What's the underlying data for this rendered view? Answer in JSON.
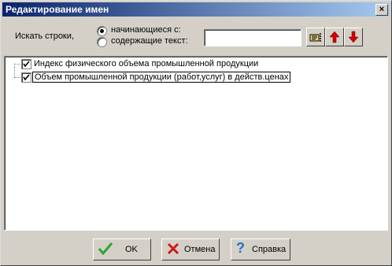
{
  "window": {
    "title": "Редактирование имен",
    "close_label": "×"
  },
  "search": {
    "label": "Искать строки,",
    "options": [
      {
        "label": "начинающиеся с:",
        "selected": true
      },
      {
        "label": "содержащие текст:",
        "selected": false
      }
    ],
    "value": "",
    "placeholder": ""
  },
  "toolbar": {
    "icons": [
      "find-hand-icon",
      "arrow-up-icon",
      "arrow-down-icon"
    ]
  },
  "list": {
    "items": [
      {
        "label": "Индекс физического объема промышленной продукции",
        "checked": true,
        "selected": false
      },
      {
        "label": "Объем промышленной продукции (работ,услуг) в действ.ценах",
        "checked": true,
        "selected": true
      }
    ]
  },
  "buttons": {
    "ok": "OK",
    "cancel": "Отмена",
    "help": "Справка"
  },
  "colors": {
    "titlebar_start": "#0a246a",
    "titlebar_end": "#a6caf0",
    "face": "#d4d0c8",
    "ok_green": "#2ca52c",
    "cancel_red": "#cc1a1a",
    "help_blue": "#1f6fd0"
  }
}
